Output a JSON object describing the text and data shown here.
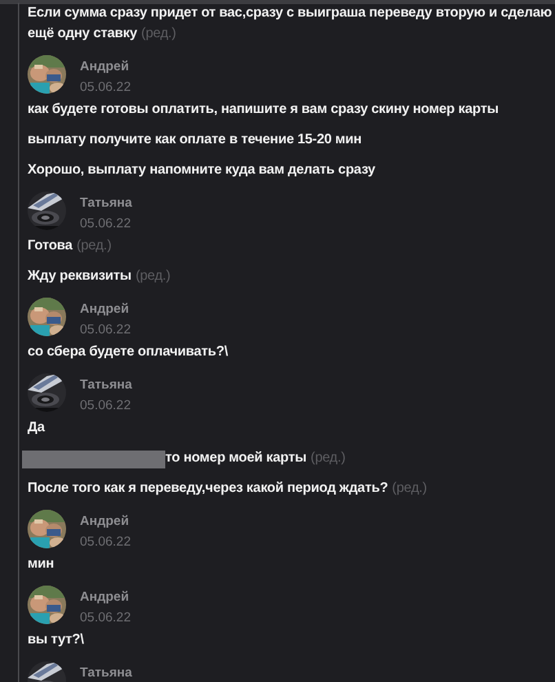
{
  "messages": [
    {
      "kind": "message",
      "text": "Если сумма сразу придет от вас,сразу с выиграша переведу вторую и сделаю ещё одну ставку",
      "redacted": false,
      "edited_label": "(ред.)"
    },
    {
      "kind": "header",
      "author": "Андрей",
      "date": "05.06.22"
    },
    {
      "kind": "message",
      "text": "как будете готовы оплатить, напишите я вам сразу скину номер карты",
      "redacted": false
    },
    {
      "kind": "message",
      "text": "выплату получите как оплате в течение 15-20 мин",
      "redacted": false
    },
    {
      "kind": "message",
      "text": "Хорошо, выплату напомните куда вам делать сразу",
      "redacted": false
    },
    {
      "kind": "header",
      "author": "Татьяна",
      "date": "05.06.22"
    },
    {
      "kind": "message",
      "text": "Готова",
      "redacted": false,
      "edited_label": "(ред.)"
    },
    {
      "kind": "message",
      "text": "Жду реквизиты",
      "redacted": false,
      "edited_label": "(ред.)"
    },
    {
      "kind": "header",
      "author": "Андрей",
      "date": "05.06.22"
    },
    {
      "kind": "message",
      "text": "со сбера будете оплачивать?\\",
      "redacted": false
    },
    {
      "kind": "header",
      "author": "Татьяна",
      "date": "05.06.22"
    },
    {
      "kind": "message",
      "text": "Да",
      "redacted": false
    },
    {
      "kind": "message",
      "text": "то номер моей карты",
      "redacted": true,
      "edited_label": "(ред.)"
    },
    {
      "kind": "message",
      "text": "После того как я переведу,через какой период ждать?",
      "redacted": false,
      "edited_label": "(ред.)"
    },
    {
      "kind": "header",
      "author": "Андрей",
      "date": "05.06.22"
    },
    {
      "kind": "message",
      "text": "мин",
      "redacted": false
    },
    {
      "kind": "header",
      "author": "Андрей",
      "date": "05.06.22"
    },
    {
      "kind": "message",
      "text": "вы тут?\\",
      "redacted": false
    },
    {
      "kind": "header",
      "author": "Татьяна"
    }
  ]
}
